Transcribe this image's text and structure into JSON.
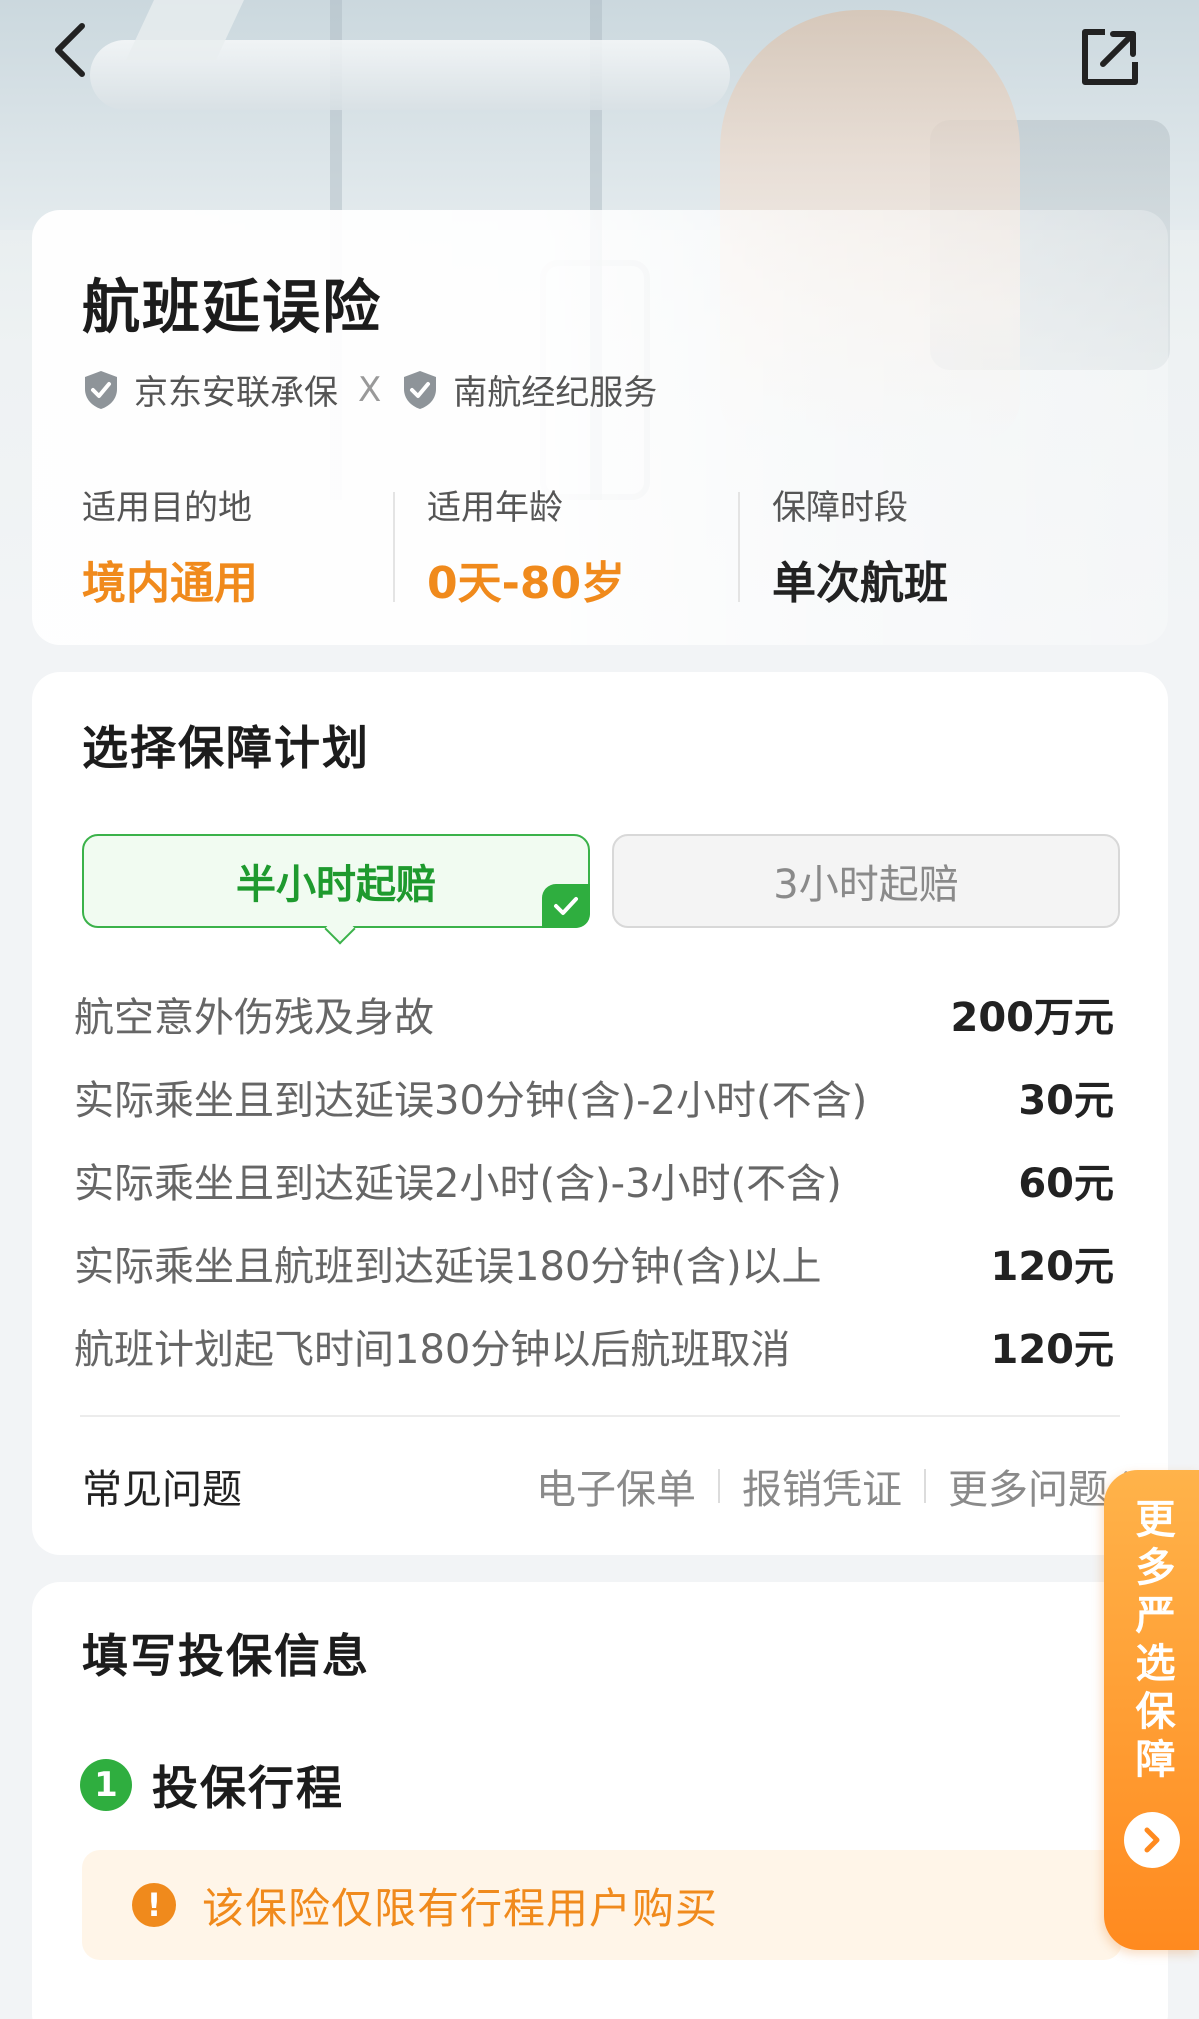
{
  "header": {
    "back_icon": "chevron-left-icon",
    "share_icon": "share-external-icon"
  },
  "product": {
    "title": "航班延误险",
    "insurer": "京东安联承保",
    "separator": "X",
    "broker": "南航经纪服务",
    "stats": [
      {
        "label": "适用目的地",
        "value": "境内通用"
      },
      {
        "label": "适用年龄",
        "value": "0天-80岁"
      },
      {
        "label": "保障时段",
        "value": "单次航班"
      }
    ]
  },
  "plan": {
    "title": "选择保障计划",
    "tabs": [
      {
        "label": "半小时起赔",
        "selected": true
      },
      {
        "label": "3小时起赔",
        "selected": false
      }
    ],
    "coverage": [
      {
        "item": "航空意外伤残及身故",
        "amount": "200万元"
      },
      {
        "item": "实际乘坐且到达延误30分钟(含)-2小时(不含)",
        "amount": "30元"
      },
      {
        "item": "实际乘坐且到达延误2小时(含)-3小时(不含)",
        "amount": "60元"
      },
      {
        "item": "实际乘坐且航班到达延误180分钟(含)以上",
        "amount": "120元"
      },
      {
        "item": "航班计划起飞时间180分钟以后航班取消",
        "amount": "120元"
      }
    ],
    "faq": {
      "title": "常见问题",
      "links": [
        "电子保单",
        "报销凭证",
        "更多问题"
      ]
    }
  },
  "form": {
    "title": "填写投保信息",
    "step_number": "1",
    "step_label": "投保行程",
    "notice": "该保险仅限有行程用户购买"
  },
  "side_tab": {
    "label": "更多严选保障"
  },
  "colors": {
    "accent_green": "#2fae3f",
    "accent_orange": "#f08a1c",
    "notice_bg": "#fff5e8"
  }
}
